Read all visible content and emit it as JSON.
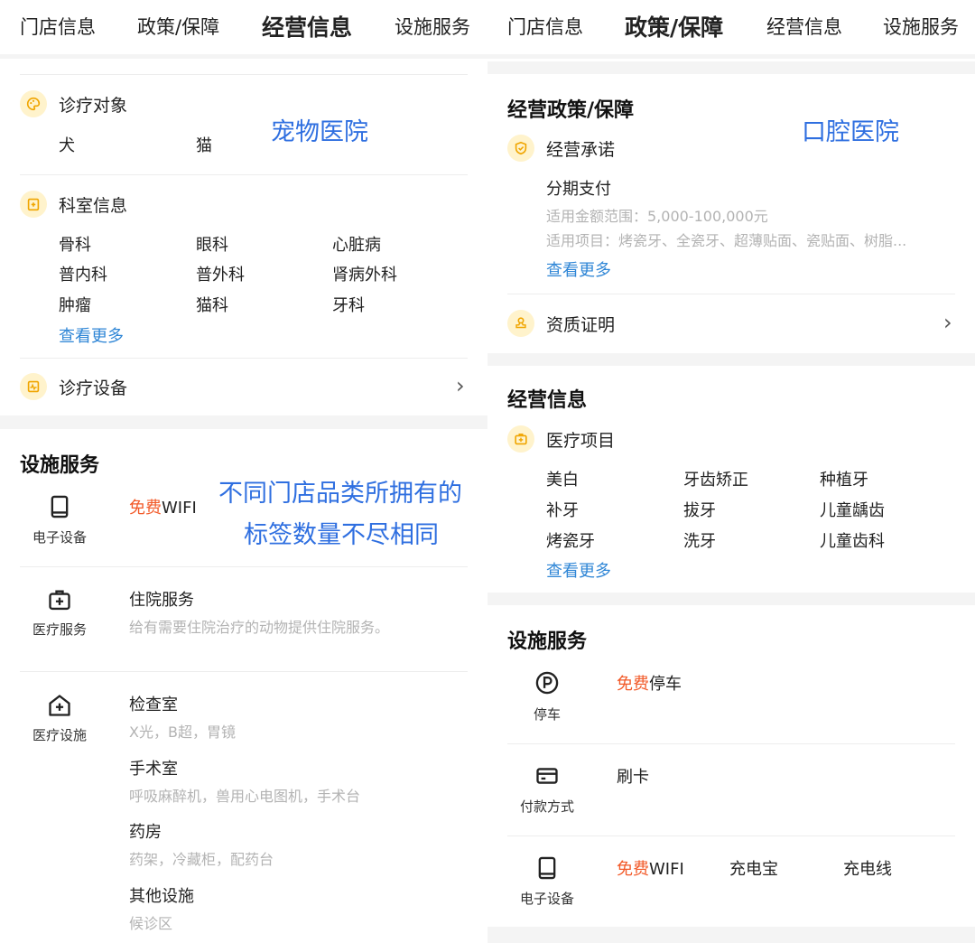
{
  "left": {
    "tabs": [
      "门店信息",
      "政策/保障",
      "经营信息",
      "设施服务"
    ],
    "active_tab": "经营信息",
    "annotation_pet": "宠物医院",
    "annotation_diff_1": "不同门店品类所拥有的",
    "annotation_diff_2": "标签数量不尽相同",
    "target": {
      "label": "诊疗对象",
      "items": [
        "犬",
        "猫"
      ]
    },
    "dept": {
      "label": "科室信息",
      "items": [
        "骨科",
        "眼科",
        "心脏病",
        "普内科",
        "普外科",
        "肾病外科",
        "肿瘤",
        "猫科",
        "牙科"
      ],
      "more": "查看更多"
    },
    "equipment": {
      "label": "诊疗设备"
    },
    "facility": {
      "title": "设施服务",
      "electronics": {
        "caption": "电子设备",
        "free": "免费",
        "item": "WIFI"
      },
      "medical_service": {
        "caption": "医疗服务",
        "title": "住院服务",
        "desc": "给有需要住院治疗的动物提供住院服务。"
      },
      "medical_facility": {
        "caption": "医疗设施",
        "items": [
          {
            "title": "检查室",
            "desc": "X光，B超，胃镜"
          },
          {
            "title": "手术室",
            "desc": "呼吸麻醉机，兽用心电图机，手术台"
          },
          {
            "title": "药房",
            "desc": "药架，冷藏柜，配药台"
          },
          {
            "title": "其他设施",
            "desc": "候诊区"
          }
        ]
      }
    }
  },
  "right": {
    "tabs": [
      "门店信息",
      "政策/保障",
      "经营信息",
      "设施服务"
    ],
    "active_tab": "政策/保障",
    "annotation": "口腔医院",
    "policy": {
      "title": "经营政策/保障",
      "promise": {
        "label": "经营承诺",
        "name": "分期支付",
        "range": "适用金额范围：5,000-100,000元",
        "projects": "适用项目：烤瓷牙、全瓷牙、超薄贴面、瓷贴面、树脂...",
        "more": "查看更多"
      },
      "qualification": {
        "label": "资质证明"
      }
    },
    "business": {
      "title": "经营信息",
      "medical": {
        "label": "医疗项目",
        "items": [
          "美白",
          "牙齿矫正",
          "种植牙",
          "补牙",
          "拔牙",
          "儿童龋齿",
          "烤瓷牙",
          "洗牙",
          "儿童齿科"
        ],
        "more": "查看更多"
      }
    },
    "facility": {
      "title": "设施服务",
      "parking": {
        "caption": "停车",
        "free": "免费",
        "item": "停车"
      },
      "payment": {
        "caption": "付款方式",
        "item": "刷卡"
      },
      "electronics": {
        "caption": "电子设备",
        "free": "免费",
        "item": "WIFI",
        "items": [
          "充电宝",
          "充电线"
        ]
      }
    }
  }
}
